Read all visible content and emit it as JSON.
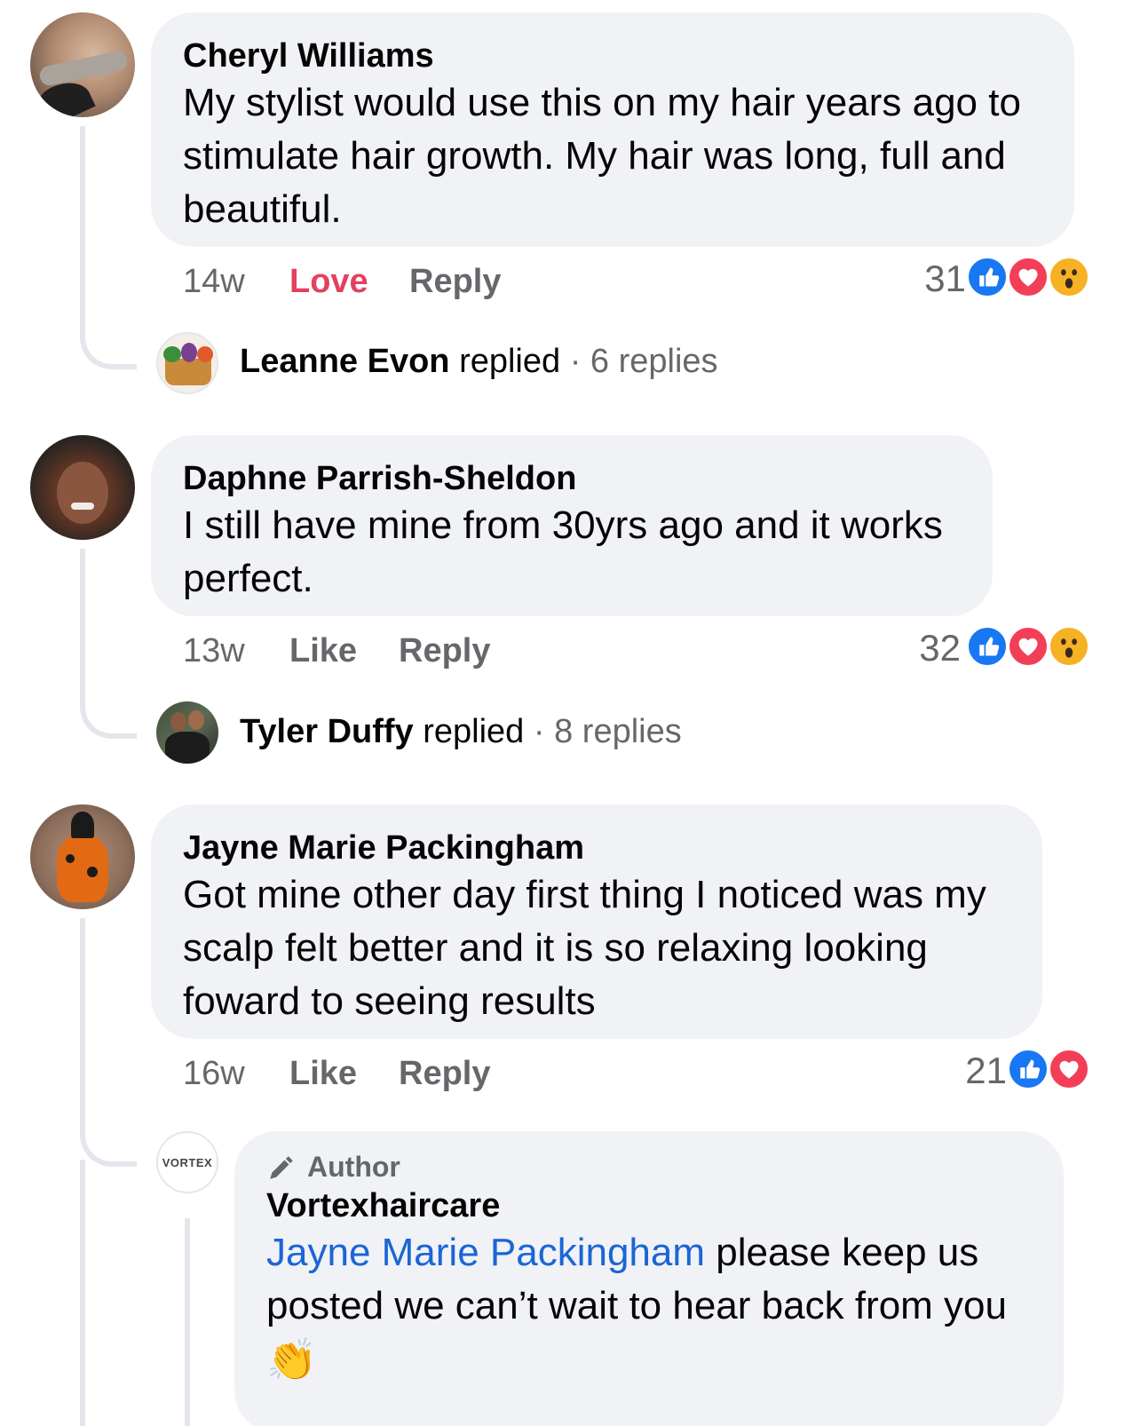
{
  "comments": [
    {
      "author": "Cheryl Williams",
      "text": "My stylist would use this on my hair years ago to stimulate hair growth. My hair was long, full and beautiful.",
      "time": "14w",
      "reaction_action": "Love",
      "reply_label": "Reply",
      "reaction_count": "31",
      "reactions": [
        "like-icon",
        "love-icon",
        "wow-icon"
      ],
      "replied": {
        "name": "Leanne Evon",
        "verb": "replied",
        "count": "6 replies"
      }
    },
    {
      "author": "Daphne Parrish-Sheldon",
      "text": "I still have mine from 30yrs ago and it works perfect.",
      "time": "13w",
      "reaction_action": "Like",
      "reply_label": "Reply",
      "reaction_count": "32",
      "reactions": [
        "like-icon",
        "love-icon",
        "wow-icon"
      ],
      "replied": {
        "name": "Tyler Duffy",
        "verb": "replied",
        "count": "8 replies"
      }
    },
    {
      "author": "Jayne Marie Packingham",
      "text": "Got mine other day first thing I noticed was my scalp felt better and it is so relaxing  looking foward to seeing results",
      "time": "16w",
      "reaction_action": "Like",
      "reply_label": "Reply",
      "reaction_count": "21",
      "reactions": [
        "like-icon",
        "love-icon"
      ]
    }
  ],
  "author_reply": {
    "badge": "Author",
    "avatar_text": "VORTEX",
    "name": "Vortexhaircare",
    "mention": "Jayne Marie Packingham",
    "text": " please keep us posted we can’t wait to hear back from you",
    "emoji": "👏"
  },
  "colors": {
    "bubble": "#f0f2f5",
    "like_blue": "#1877f2",
    "love_red": "#f33e58",
    "wow_yellow": "#f7b125",
    "love_action": "#e4405f",
    "mention": "#1b65d6",
    "secondary_text": "#65676b"
  }
}
